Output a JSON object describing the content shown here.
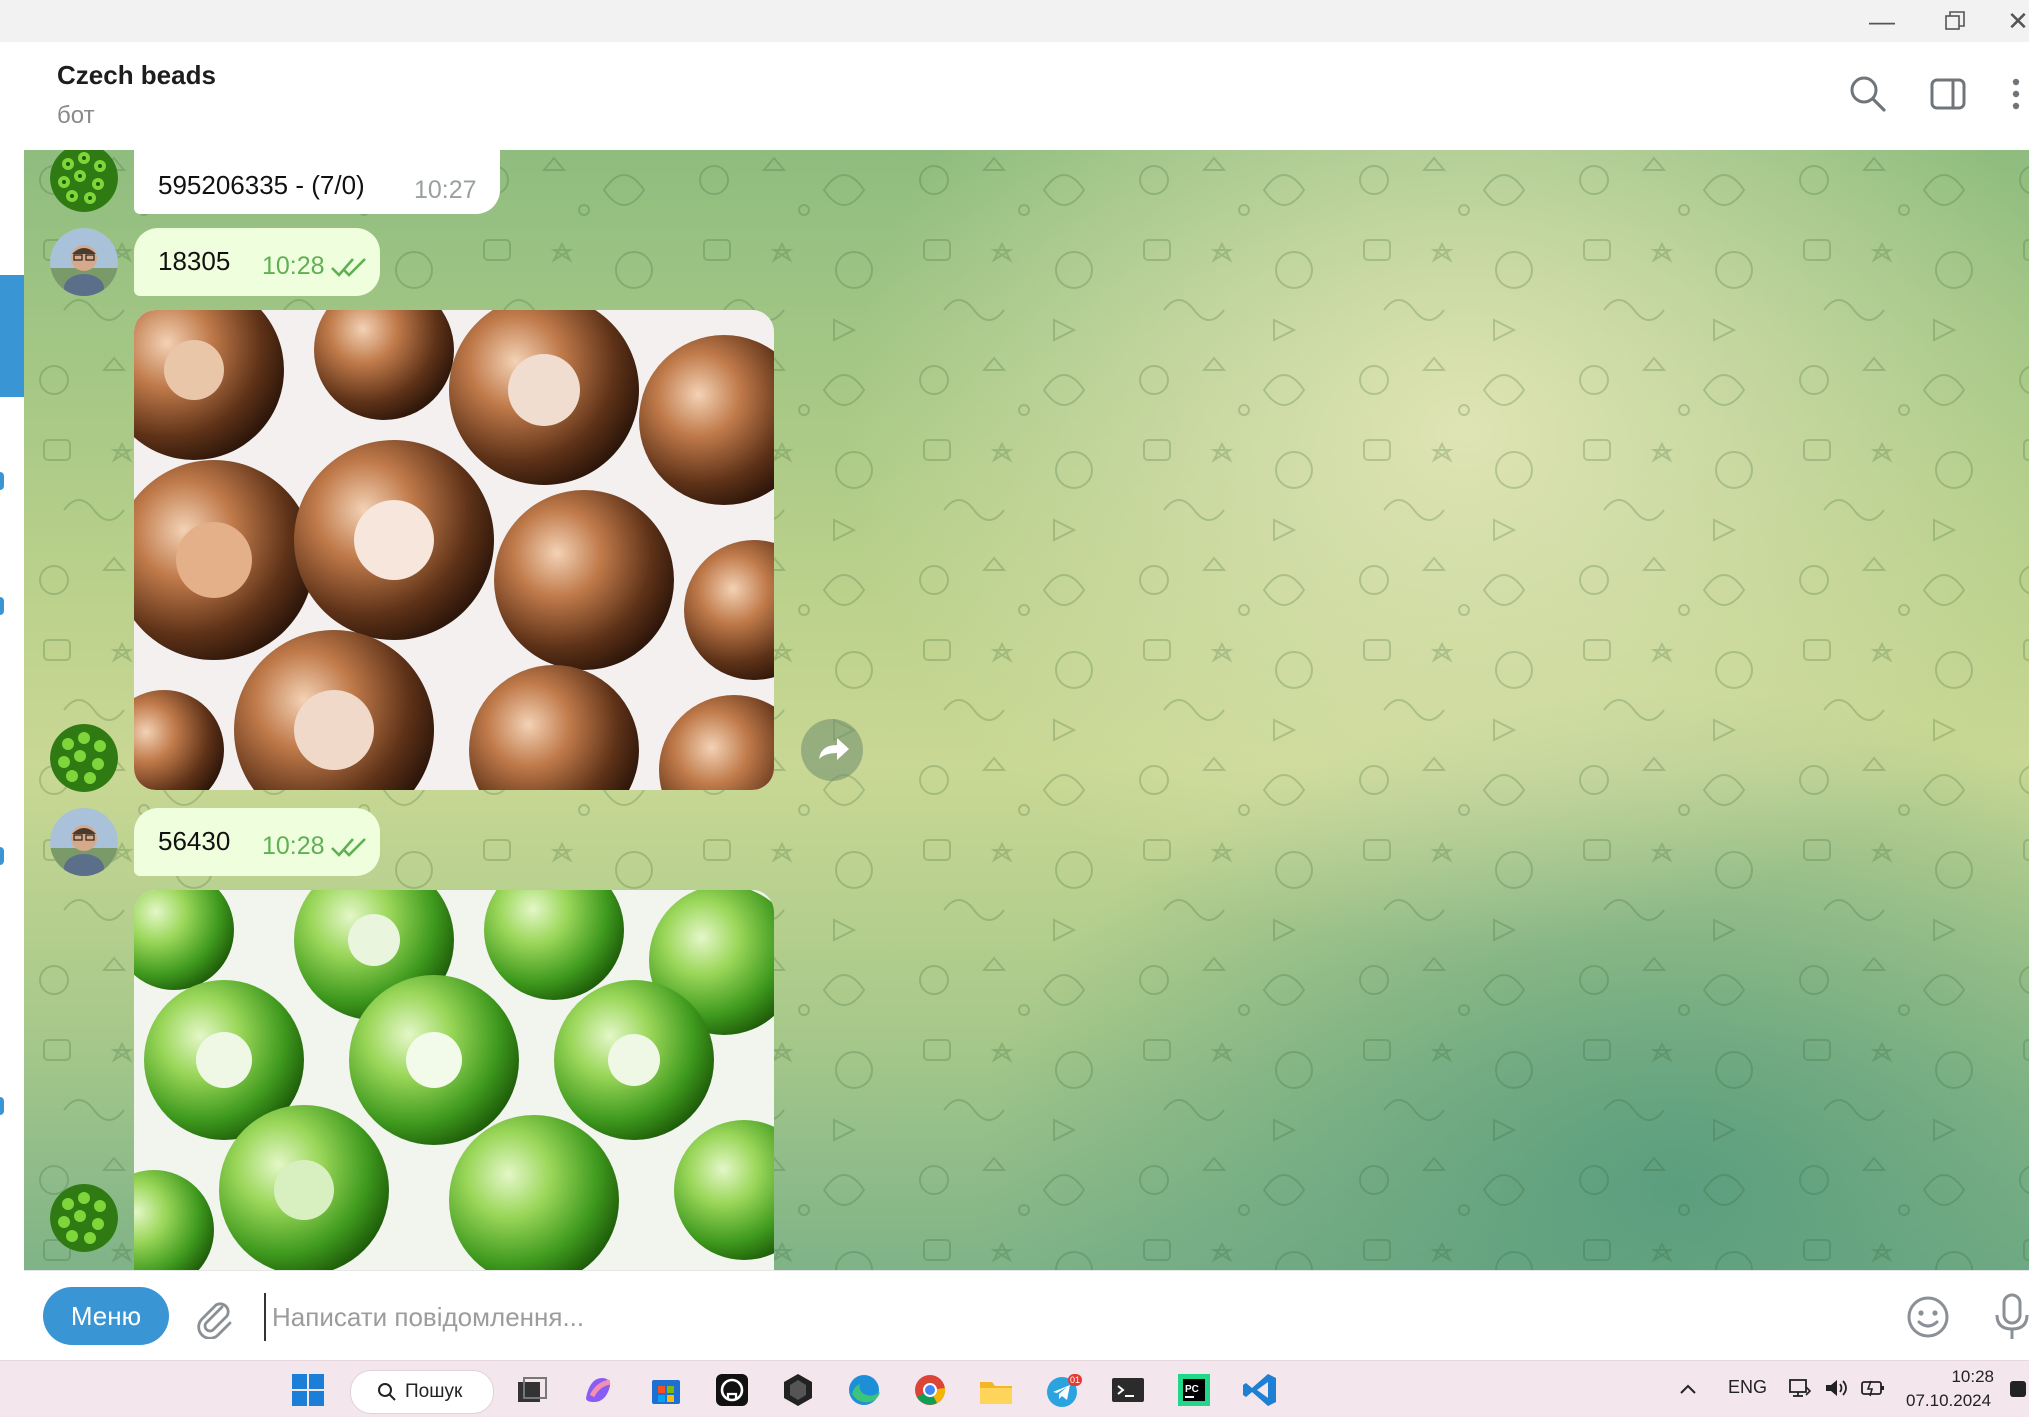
{
  "window": {
    "minimize_icon": "minimize-icon",
    "restore_icon": "restore-icon",
    "close_icon": "close-icon"
  },
  "header": {
    "title": "Czech beads",
    "subtitle": "бот"
  },
  "messages": [
    {
      "type": "text",
      "direction": "in",
      "text": "595206335 - (7/0)",
      "time": "10:27"
    },
    {
      "type": "text",
      "direction": "out",
      "text": "18305",
      "time": "10:28",
      "status": "read"
    },
    {
      "type": "photo",
      "direction": "in",
      "subject": "copper beads"
    },
    {
      "type": "text",
      "direction": "out",
      "text": "56430",
      "time": "10:28",
      "status": "read"
    },
    {
      "type": "photo",
      "direction": "in",
      "subject": "green beads"
    }
  ],
  "composer": {
    "menu_label": "Меню",
    "placeholder": "Написати повідомлення..."
  },
  "taskbar": {
    "search_label": "Пошук",
    "language": "ENG",
    "time": "10:28",
    "date": "07.10.2024",
    "telegram_badge": "01"
  },
  "colors": {
    "accent": "#3a95d5",
    "outgoing_bubble": "#effedd",
    "incoming_bubble": "#ffffff",
    "read_check": "#5fb053"
  }
}
